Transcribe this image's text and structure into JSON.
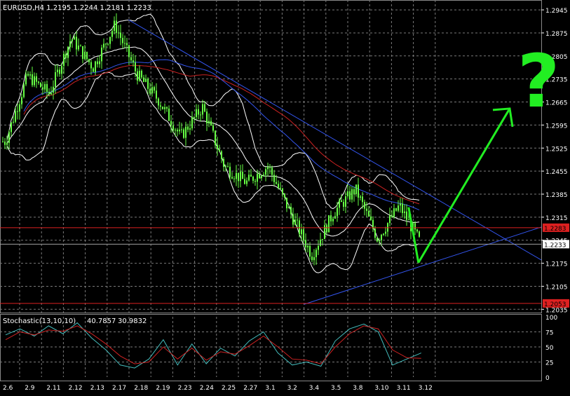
{
  "symbol_header": "EURUSD,H4  1.2195 1.2244 1.2181 1.2233",
  "colors": {
    "background": "#000000",
    "grid": "#7a7a7a",
    "candles": "#66ff44",
    "bands": "#ffffff",
    "ma_slow": "#cc2222",
    "ma_blue": "#3355ee",
    "trendline": "#3355ee",
    "level_line": "#dd2020",
    "price_line": "#a0a0a0",
    "stoch_main": "#44bbbb",
    "stoch_signal": "#cc2222",
    "annotation": "#22ee22",
    "axis_text": "#ffffff"
  },
  "main_panel": {
    "y_ticks": [
      "1.2945",
      "1.2875",
      "1.2805",
      "1.2735",
      "1.2665",
      "1.2595",
      "1.2525",
      "1.2455",
      "1.2385",
      "1.2315",
      "1.2245",
      "1.2175",
      "1.2105",
      "1.2035"
    ],
    "price_labels": [
      {
        "text": "1.2283",
        "value": 1.2283,
        "bg": "#dd2020"
      },
      {
        "text": "1.2233",
        "value": 1.2233,
        "bg": "#ffffff"
      },
      {
        "text": "1.2053",
        "value": 1.2053,
        "bg": "#dd2020"
      }
    ]
  },
  "stoch_panel": {
    "label": "Stochastic(13,10,10)",
    "value_main": "40.7857",
    "value_signal": "30.9832",
    "y_ticks": [
      "100",
      "75",
      "50",
      "25",
      "0"
    ]
  },
  "x_ticks": [
    "2.6",
    "2.9",
    "2.11",
    "2.12",
    "2.13",
    "2.17",
    "2.18",
    "2.19",
    "2.23",
    "2.24",
    "2.25",
    "2.27",
    "3.1",
    "3.2",
    "3.4",
    "3.5",
    "3.8",
    "3.10",
    "3.11",
    "3.12"
  ],
  "annotation": {
    "question_mark": "?"
  },
  "chart_data": {
    "type": "candlestick",
    "symbol": "EURUSD",
    "timeframe": "H4",
    "last_bar": {
      "open": 1.2195,
      "high": 1.2244,
      "low": 1.2181,
      "close": 1.2233
    },
    "price_range": [
      1.2025,
      1.2975
    ],
    "close_path_by_tick": [
      {
        "x": "2.6",
        "close": 1.2545
      },
      {
        "x": "2.9",
        "close": 1.2745
      },
      {
        "x": "2.11",
        "close": 1.269
      },
      {
        "x": "2.12",
        "close": 1.286
      },
      {
        "x": "2.13",
        "close": 1.277
      },
      {
        "x": "2.17",
        "close": 1.29
      },
      {
        "x": "2.18",
        "close": 1.275
      },
      {
        "x": "2.19",
        "close": 1.267
      },
      {
        "x": "2.23",
        "close": 1.256
      },
      {
        "x": "2.24",
        "close": 1.265
      },
      {
        "x": "2.25",
        "close": 1.247
      },
      {
        "x": "2.27",
        "close": 1.242
      },
      {
        "x": "3.1",
        "close": 1.247
      },
      {
        "x": "3.2",
        "close": 1.233
      },
      {
        "x": "3.4",
        "close": 1.22
      },
      {
        "x": "3.5",
        "close": 1.233
      },
      {
        "x": "3.8",
        "close": 1.24
      },
      {
        "x": "3.10",
        "close": 1.225
      },
      {
        "x": "3.11",
        "close": 1.235
      },
      {
        "x": "3.12",
        "close": 1.2233
      }
    ],
    "horizontal_levels": [
      1.2283,
      1.2053
    ],
    "current_price": 1.2233,
    "stochastic": {
      "params": "13,10,10",
      "main_last": 40.7857,
      "signal_last": 30.9832,
      "range": [
        0,
        100
      ],
      "main": [
        70,
        80,
        68,
        85,
        72,
        90,
        65,
        45,
        20,
        15,
        30,
        62,
        20,
        55,
        22,
        48,
        35,
        60,
        75,
        40,
        20,
        25,
        18,
        60,
        80,
        88,
        75,
        20,
        30,
        40
      ],
      "signal": [
        62,
        75,
        70,
        78,
        76,
        85,
        72,
        55,
        35,
        22,
        25,
        50,
        30,
        48,
        28,
        42,
        38,
        52,
        68,
        50,
        30,
        28,
        22,
        50,
        72,
        85,
        80,
        45,
        32,
        31
      ]
    }
  }
}
